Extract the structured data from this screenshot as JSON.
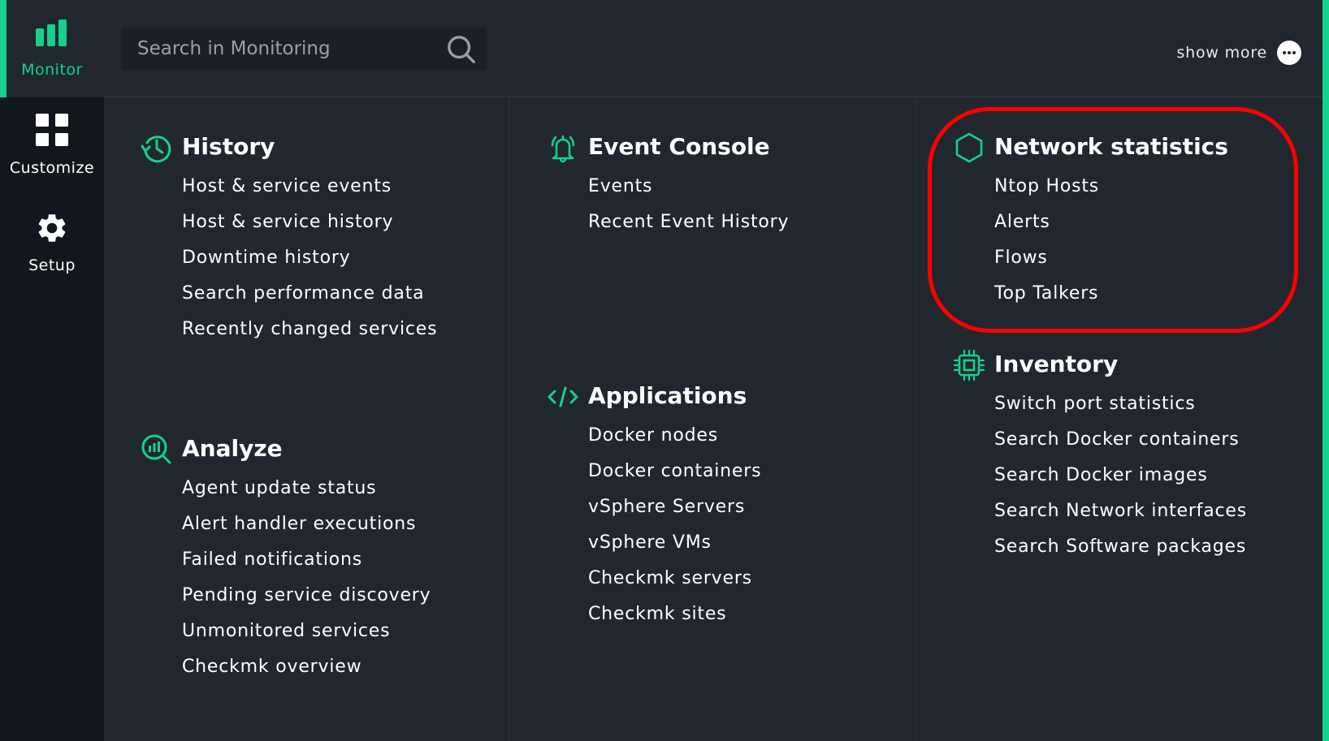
{
  "sidebar": {
    "items": [
      {
        "label": "Monitor",
        "icon": "bar-chart-icon",
        "active": true
      },
      {
        "label": "Customize",
        "icon": "grid-icon",
        "active": false
      },
      {
        "label": "Setup",
        "icon": "gear-icon",
        "active": false
      }
    ]
  },
  "header": {
    "search": {
      "placeholder": "Search in Monitoring",
      "value": "",
      "icon": "search-icon"
    },
    "show_more": {
      "label": "show more",
      "icon": "more-dots-icon"
    }
  },
  "colors": {
    "accent": "#15d18b",
    "background": "#21272f",
    "sidebar": "#12171d",
    "highlight": "#ff0000"
  },
  "sections": {
    "history": {
      "title": "History",
      "icon": "history-icon",
      "items": [
        "Host & service events",
        "Host & service history",
        "Downtime history",
        "Search performance data",
        "Recently changed services"
      ]
    },
    "analyze": {
      "title": "Analyze",
      "icon": "analyze-icon",
      "items": [
        "Agent update status",
        "Alert handler executions",
        "Failed notifications",
        "Pending service discovery",
        "Unmonitored services",
        "Checkmk overview"
      ]
    },
    "event_console": {
      "title": "Event Console",
      "icon": "bell-icon",
      "items": [
        "Events",
        "Recent Event History"
      ]
    },
    "applications": {
      "title": "Applications",
      "icon": "code-icon",
      "items": [
        "Docker nodes",
        "Docker containers",
        "vSphere Servers",
        "vSphere VMs",
        "Checkmk servers",
        "Checkmk sites"
      ]
    },
    "network_statistics": {
      "title": "Network statistics",
      "icon": "hexagon-icon",
      "items": [
        "Ntop Hosts",
        "Alerts",
        "Flows",
        "Top Talkers"
      ]
    },
    "inventory": {
      "title": "Inventory",
      "icon": "chip-icon",
      "items": [
        "Switch port statistics",
        "Search Docker containers",
        "Search Docker images",
        "Search Network interfaces",
        "Search Software packages"
      ]
    }
  }
}
